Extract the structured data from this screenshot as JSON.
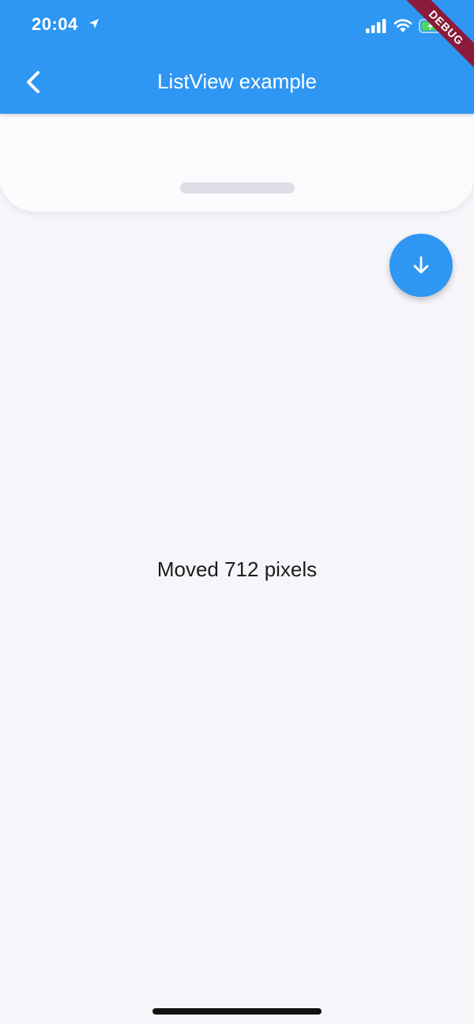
{
  "status_bar": {
    "time": "20:04",
    "icons": [
      "location-arrow-icon",
      "cellular-signal-icon",
      "wifi-icon",
      "battery-charging-icon"
    ]
  },
  "debug_banner": {
    "label": "DEBUG",
    "color": "#8b1b3a"
  },
  "app_bar": {
    "title": "ListView example",
    "back_icon": "chevron-left-icon",
    "color": "#2e96f3"
  },
  "fab": {
    "icon": "arrow-down-icon",
    "color": "#2e96f3"
  },
  "body": {
    "message": "Moved 712 pixels"
  }
}
